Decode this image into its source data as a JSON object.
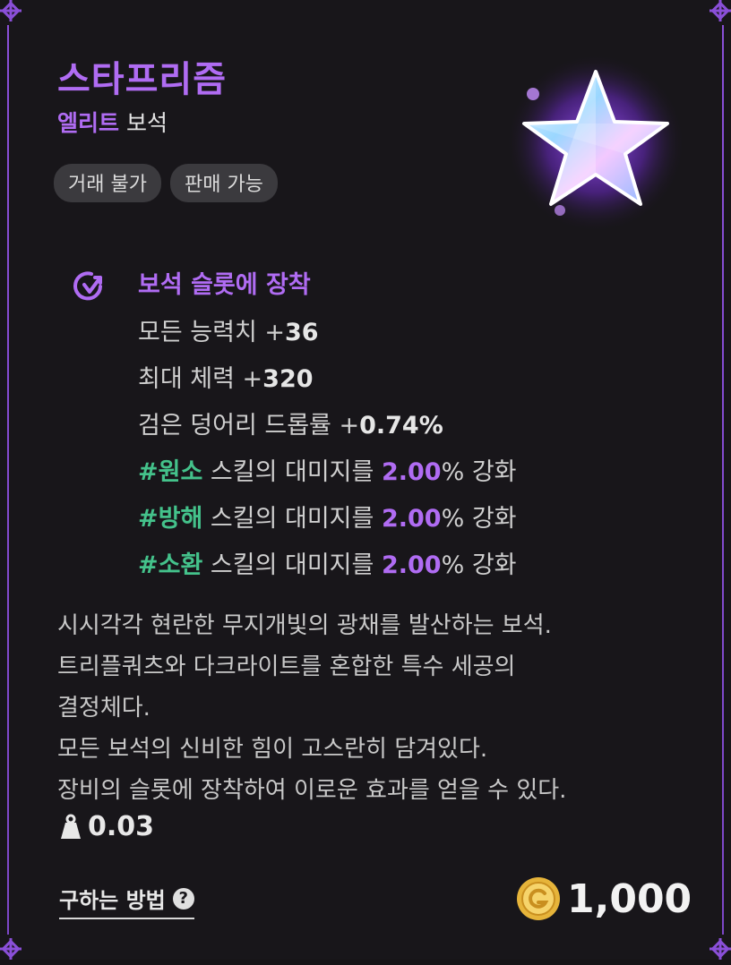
{
  "item": {
    "name": "스타프리즘",
    "grade": "엘리트",
    "category": "보석"
  },
  "tags": [
    "거래 불가",
    "판매 가능"
  ],
  "effect": {
    "title": "보석 슬롯에 장착",
    "stats": [
      {
        "label": "모든 능력치 +",
        "value": "36"
      },
      {
        "label": "최대 체력 +",
        "value": "320"
      },
      {
        "label": "검은 덩어리 드롭률 +",
        "value": "0.74%"
      }
    ],
    "skills": [
      {
        "tag": "#원소",
        "text": " 스킬의 대미지를 ",
        "value": "2.00",
        "unit": "%",
        "suffix": " 강화"
      },
      {
        "tag": "#방해",
        "text": " 스킬의 대미지를 ",
        "value": "2.00",
        "unit": "%",
        "suffix": " 강화"
      },
      {
        "tag": "#소환",
        "text": " 스킬의 대미지를 ",
        "value": "2.00",
        "unit": "%",
        "suffix": " 강화"
      }
    ]
  },
  "description": [
    "시시각각 현란한 무지개빛의 광채를 발산하는 보석.",
    "트리플쿼츠와 다크라이트를 혼합한 특수 세공의",
    "결정체다.",
    "모든 보석의 신비한 힘이 고스란히 담겨있다.",
    "장비의 슬롯에 장착하여 이로운 효과를 얻을 수 있다."
  ],
  "weight": "0.03",
  "how_to_obtain": "구하는 방법",
  "price": "1,000",
  "icons": {
    "gem": "star-gem-icon",
    "equip": "equip-slot-icon",
    "weight": "weight-icon",
    "help": "help-icon",
    "coin": "gold-coin-icon"
  },
  "colors": {
    "accent": "#b06cf3",
    "skill_tag": "#44c28b",
    "background": "#18161a"
  }
}
